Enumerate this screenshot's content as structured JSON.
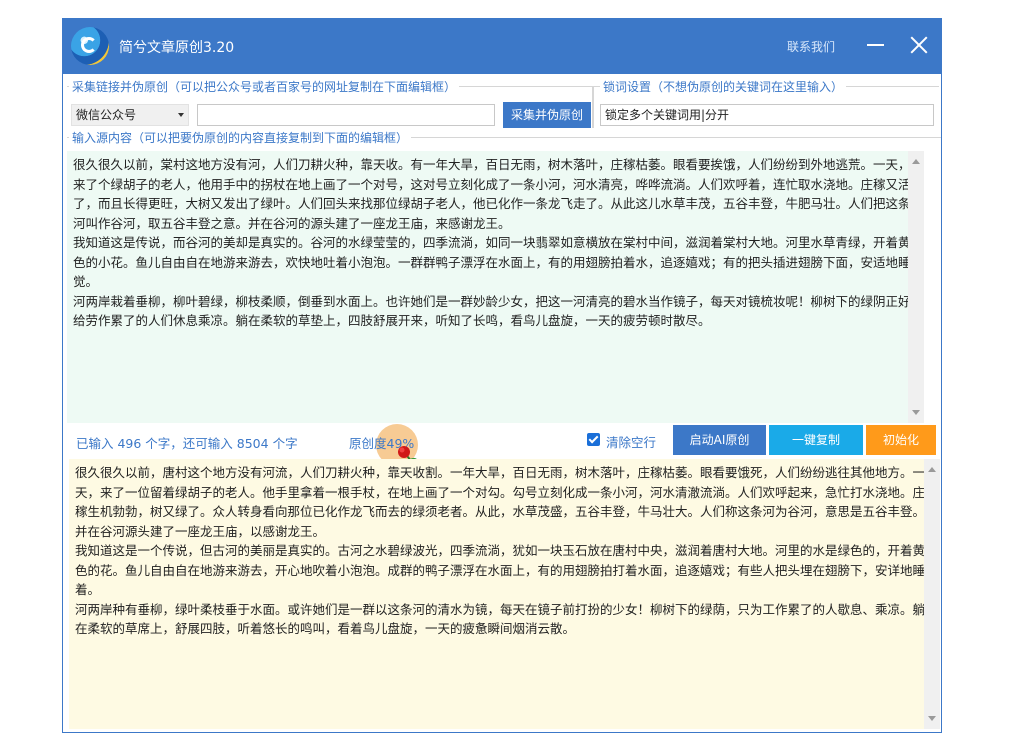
{
  "app": {
    "title": "简兮文章原创3.20",
    "contact_label": "联系我们"
  },
  "collect": {
    "legend": "采集链接并伪原创（可以把公众号或者百家号的网址复制在下面编辑框）",
    "source_selected": "微信公众号",
    "url_value": "",
    "button_label": "采集并伪原创"
  },
  "lock": {
    "legend": "锁词设置（不想伪原创的关键词在这里输入）",
    "input_value": "锁定多个关键词用|分开"
  },
  "source": {
    "legend": "输入源内容（可以把要伪原创的内容直接复制到下面的编辑框）",
    "text": "很久很久以前，棠村这地方没有河，人们刀耕火种，靠天收。有一年大旱，百日无雨，树木落叶，庄稼枯萎。眼看要挨饿，人们纷纷到外地逃荒。一天，来了个绿胡子的老人，他用手中的拐杖在地上画了一个对号，这对号立刻化成了一条小河，河水清亮，哗哗流淌。人们欢呼着，连忙取水浇地。庄稼又活了，而且长得更旺，大树又发出了绿叶。人们回头来找那位绿胡子老人，他已化作一条龙飞走了。从此这儿水草丰茂，五谷丰登，牛肥马壮。人们把这条河叫作谷河，取五谷丰登之意。并在谷河的源头建了一座龙王庙，来感谢龙王。\n我知道这是传说，而谷河的美却是真实的。谷河的水绿莹莹的，四季流淌，如同一块翡翠如意横放在棠村中间，滋润着棠村大地。河里水草青绿，开着黄色的小花。鱼儿自由自在地游来游去，欢快地吐着小泡泡。一群群鸭子漂浮在水面上，有的用翅膀拍着水，追逐嬉戏；有的把头插进翅膀下面，安适地睡觉。\n河两岸栽着垂柳，柳叶碧绿，柳枝柔顺，倒垂到水面上。也许她们是一群妙龄少女，把这一河清亮的碧水当作镜子，每天对镜梳妆呢！柳树下的绿阴正好给劳作累了的人们休息乘凉。躺在柔软的草垫上，四肢舒展开来，听知了长鸣，看鸟儿盘旋，一天的疲劳顿时散尽。"
  },
  "status": {
    "count_text": "已输入 496 个字，还可输入 8504 个字",
    "originality_text": "原创度49%",
    "originality_percent": 49
  },
  "options": {
    "clear_blank_lines_label": "清除空行",
    "clear_blank_lines_checked": true
  },
  "buttons": {
    "start_ai": {
      "label": "启动AI原创",
      "color": "#3c78c8"
    },
    "copy": {
      "label": "一键复制",
      "color": "#1aaae8"
    },
    "reset": {
      "label": "初始化",
      "color": "#ff9a1a"
    }
  },
  "output": {
    "text": "很久很久以前，唐村这个地方没有河流，人们刀耕火种，靠天收割。一年大旱，百日无雨，树木落叶，庄稼枯萎。眼看要饿死，人们纷纷逃往其他地方。一天，来了一位留着绿胡子的老人。他手里拿着一根手杖，在地上画了一个对勾。勾号立刻化成一条小河，河水清澈流淌。人们欢呼起来，急忙打水浇地。庄稼生机勃勃，树又绿了。众人转身看向那位已化作龙飞而去的绿须老者。从此，水草茂盛，五谷丰登，牛马壮大。人们称这条河为谷河，意思是五谷丰登。并在谷河源头建了一座龙王庙，以感谢龙王。\n我知道这是一个传说，但古河的美丽是真实的。古河之水碧绿波光，四季流淌，犹如一块玉石放在唐村中央，滋润着唐村大地。河里的水是绿色的，开着黄色的花。鱼儿自由自在地游来游去，开心地吹着小泡泡。成群的鸭子漂浮在水面上，有的用翅膀拍打着水面，追逐嬉戏；有些人把头埋在翅膀下，安详地睡着。\n河两岸种有垂柳，绿叶柔枝垂于水面。或许她们是一群以这条河的清水为镜，每天在镜子前打扮的少女！柳树下的绿荫，只为工作累了的人歇息、乘凉。躺在柔软的草席上，舒展四肢，听着悠长的鸣叫，看着鸟儿盘旋，一天的疲惫瞬间烟消云散。"
  }
}
